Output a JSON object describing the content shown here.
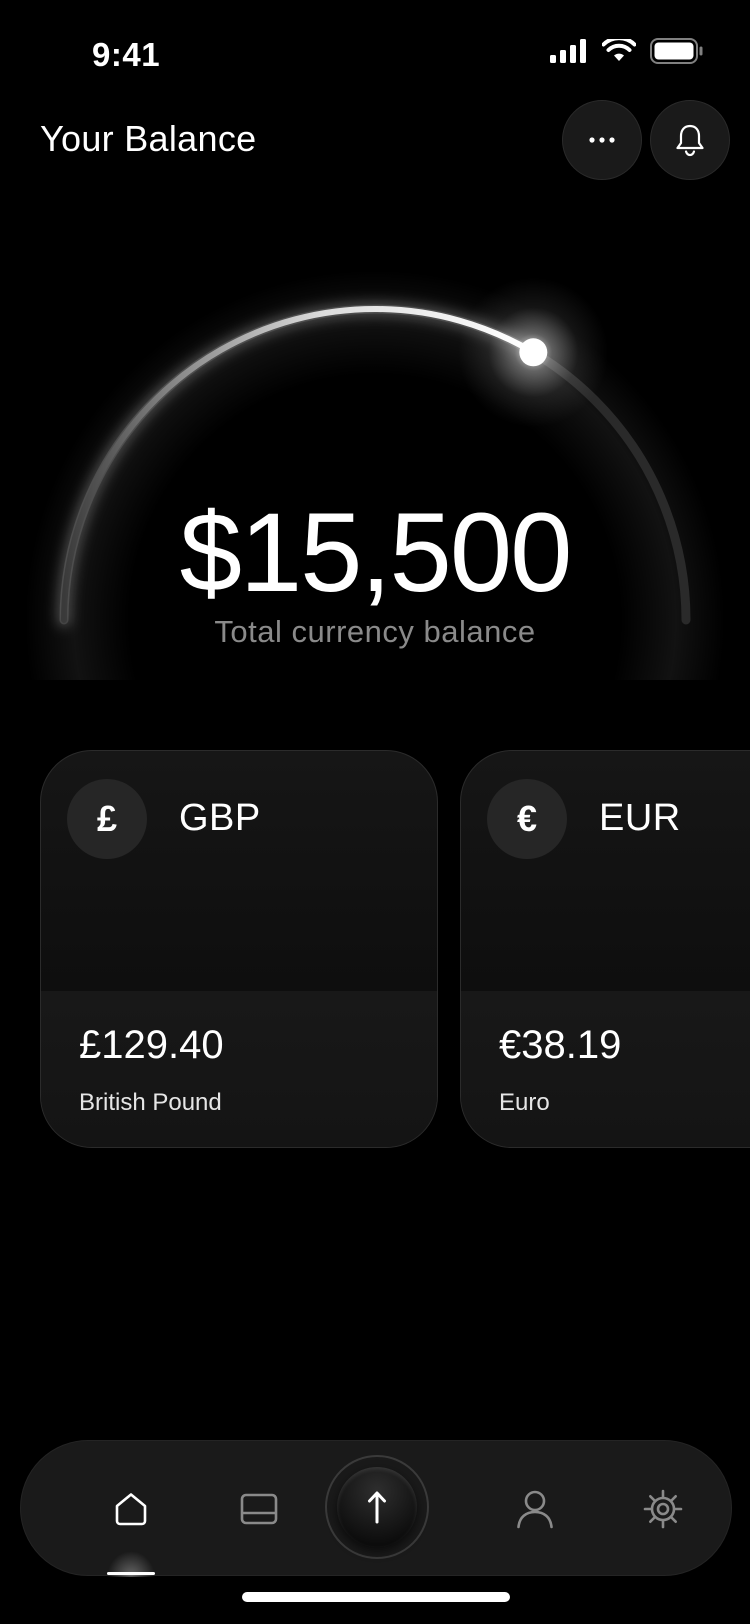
{
  "status_bar": {
    "time": "9:41",
    "icons": [
      "cellular-signal-icon",
      "wifi-icon",
      "battery-icon"
    ]
  },
  "header": {
    "title": "Your Balance",
    "more_icon": "more-dots-icon",
    "notifications_icon": "bell-icon"
  },
  "balance": {
    "amount": "$15,500",
    "caption": "Total currency balance",
    "gauge_progress": 0.67
  },
  "cards": [
    {
      "symbol": "£",
      "code": "GBP",
      "amount": "£129.40",
      "name": "British Pound"
    },
    {
      "symbol": "€",
      "code": "EUR",
      "amount": "€38.19",
      "name": "Euro"
    }
  ],
  "bottom_nav": {
    "items": [
      {
        "icon": "home-icon",
        "active": true
      },
      {
        "icon": "cards-icon",
        "active": false
      },
      {
        "icon": "send-arrow-up-icon",
        "active": false
      },
      {
        "icon": "profile-icon",
        "active": false
      },
      {
        "icon": "settings-gear-icon",
        "active": false
      }
    ]
  },
  "colors": {
    "background": "#000000",
    "surface": "#1a1a1a",
    "text_primary": "#ffffff",
    "text_secondary": "#8a8a8a"
  }
}
